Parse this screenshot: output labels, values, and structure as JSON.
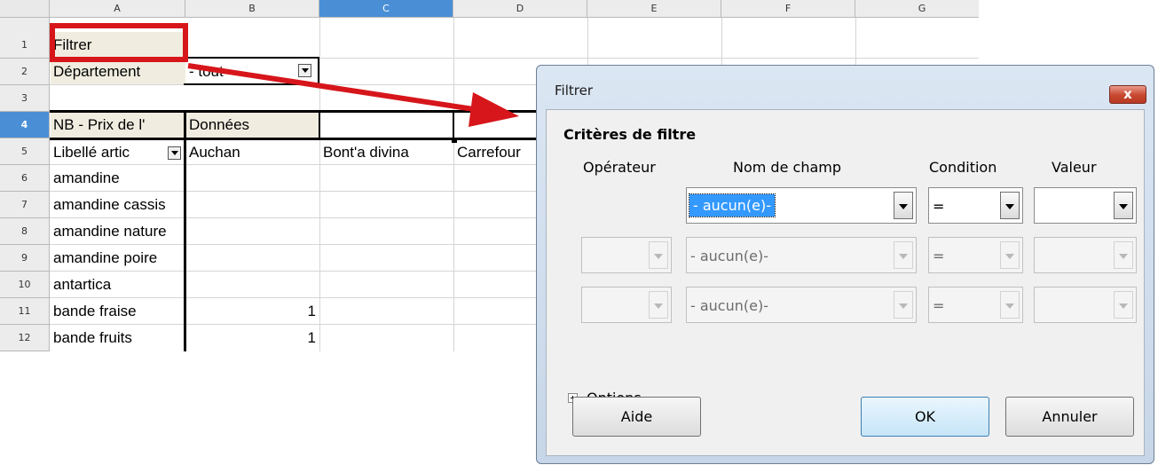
{
  "spreadsheet": {
    "columns": [
      "A",
      "B",
      "C",
      "D",
      "E",
      "F",
      "G"
    ],
    "selected_column": "C",
    "rows": [
      "1",
      "2",
      "3",
      "4",
      "5",
      "6",
      "7",
      "8",
      "9",
      "10",
      "11",
      "12"
    ],
    "selected_row": "4",
    "cells": {
      "a1": "Filtrer",
      "a2": "Département",
      "b2": "- tout -",
      "a4": "NB - Prix de l'",
      "b4": "Données",
      "a5": "Libellé artic",
      "b5": "Auchan",
      "c5": "Bont'a divina",
      "d5": "Carrefour",
      "a6": "amandine",
      "a7": "amandine cassis",
      "a8": "amandine nature",
      "a9": "amandine poire",
      "a10": "antartica",
      "a11": "bande fraise",
      "b11": "1",
      "a12": "bande fruits",
      "b12": "1"
    },
    "annotation_color": "#d6161b"
  },
  "dialog": {
    "title": "Filtrer",
    "close_label": "x",
    "section_title": "Critères de filtre",
    "headers": {
      "operator": "Opérateur",
      "field_name": "Nom de champ",
      "condition": "Condition",
      "value": "Valeur"
    },
    "rows": [
      {
        "operator": "",
        "field": "- aucun(e)-",
        "condition": "=",
        "value": ""
      },
      {
        "operator": "",
        "field": "- aucun(e)-",
        "condition": "=",
        "value": ""
      },
      {
        "operator": "",
        "field": "- aucun(e)-",
        "condition": "=",
        "value": ""
      }
    ],
    "options_label": "Options",
    "help_label": "Aide",
    "ok_label": "OK",
    "cancel_label": "Annuler"
  }
}
